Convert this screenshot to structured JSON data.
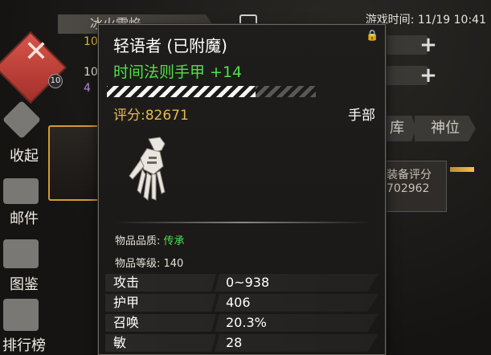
{
  "background": {
    "game_time": "游戏时间: 11/19 10:41",
    "character_name": "冰火雷焰",
    "level": "10",
    "stat_values": [
      "10",
      "10",
      "4"
    ],
    "side_menu": [
      "收起",
      "邮件",
      "图鉴",
      "排行榜"
    ],
    "right_tabs": [
      "库",
      "神位"
    ],
    "equip_score_label": "装备评分",
    "equip_score_value": "702962"
  },
  "tooltip": {
    "name": "轻语者 (已附魔)",
    "enchant": "时间法则手甲 +14",
    "progress": 0.71,
    "score": "评分:82671",
    "slot": "手部",
    "quality_label": "物品品质: ",
    "quality_value": "传承",
    "level_label": "物品等级: 140",
    "stats": [
      {
        "label": "攻击",
        "value": "0~938"
      },
      {
        "label": "护甲",
        "value": "406"
      },
      {
        "label": "召唤",
        "value": "20.3%"
      },
      {
        "label": "敏",
        "value": "28"
      }
    ]
  },
  "colors": {
    "enchant_green": "#4fe04c",
    "score_gold": "#e7b84f",
    "emblem_red": "#c9413a"
  },
  "icons": [
    "lock-icon",
    "gauntlet-icon",
    "edit-icon",
    "plus-icon",
    "mail-icon",
    "book-icon",
    "chart-icon",
    "collapse-icon"
  ]
}
